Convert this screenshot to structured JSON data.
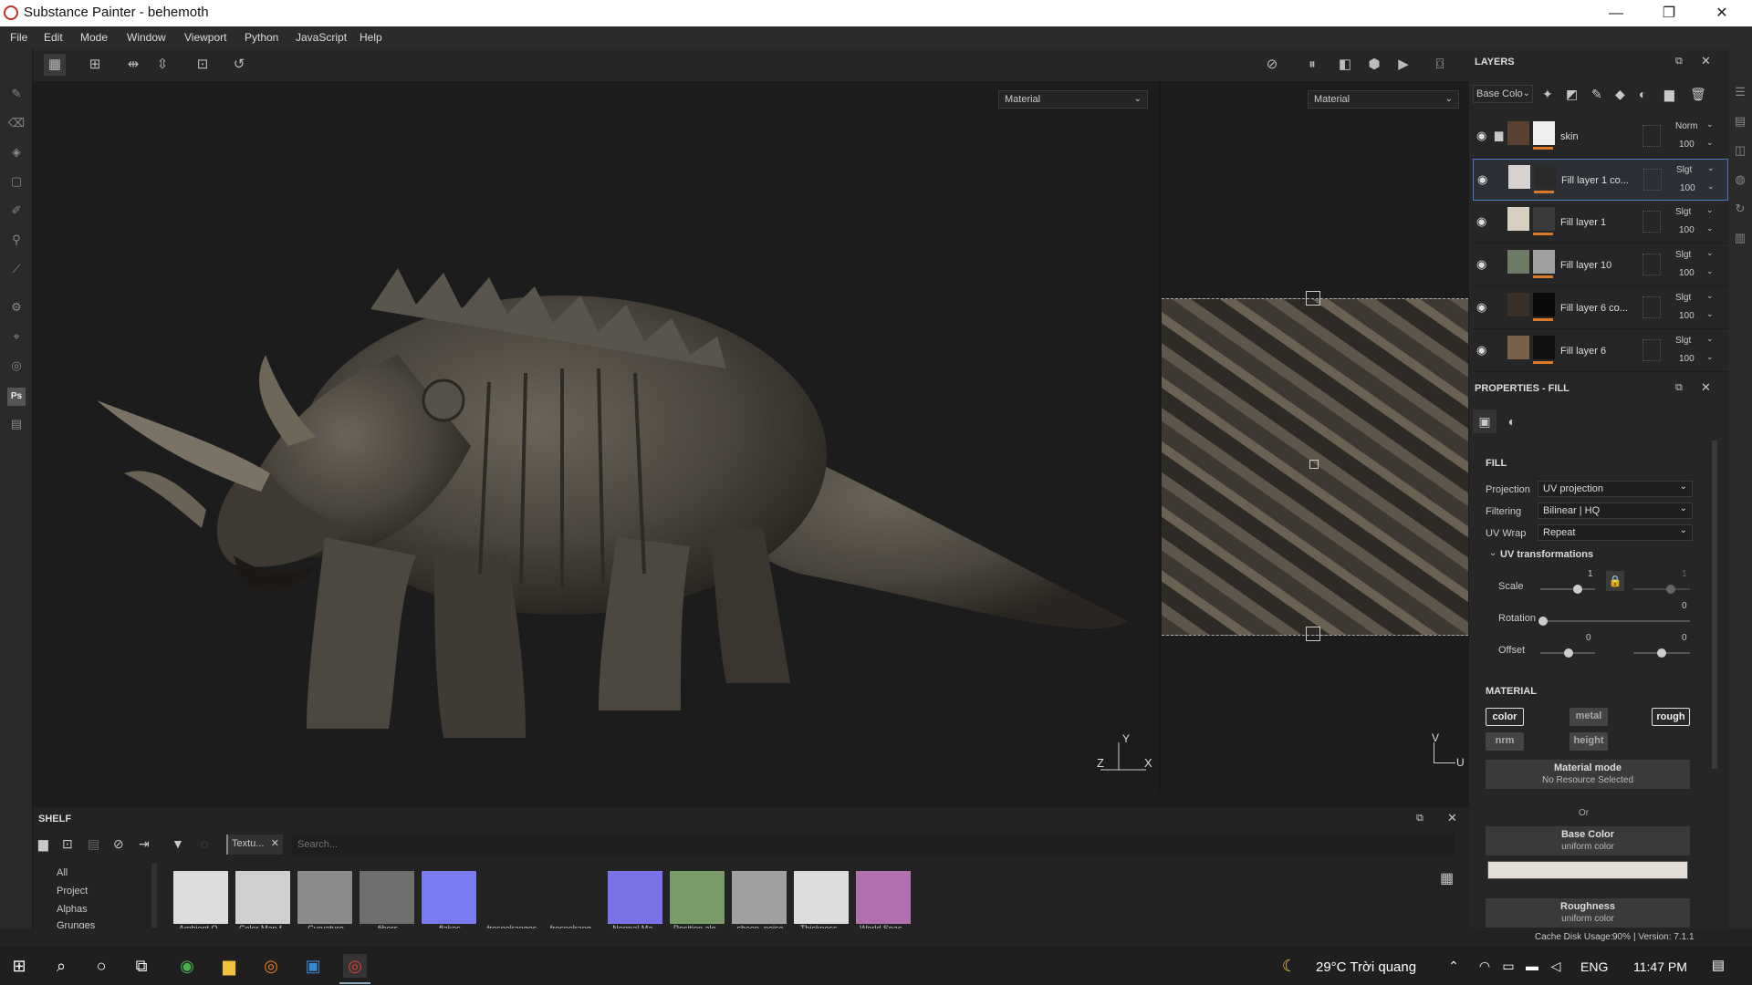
{
  "app": {
    "title": "Substance Painter - behemoth",
    "min": "—",
    "max": "❐",
    "close": "✕"
  },
  "menu": [
    "File",
    "Edit",
    "Mode",
    "Window",
    "Viewport",
    "Python",
    "JavaScript",
    "Help"
  ],
  "viewport": {
    "left_mode": "Material",
    "right_mode": "Material",
    "axis_y": "Y",
    "axis_x": "X",
    "axis_z": "Z",
    "uv_v": "V",
    "uv_u": "U"
  },
  "layers": {
    "title": "LAYERS",
    "channel": "Base Colo",
    "items": [
      {
        "name": "skin",
        "blend": "Norm",
        "opacity": "100",
        "color": "#5a4030",
        "mask": "#f0f0f0"
      },
      {
        "name": "Fill layer 1 co...",
        "blend": "Slgt",
        "opacity": "100",
        "color": "#d8d2ce",
        "mask": "#2a2a2a",
        "selected": true
      },
      {
        "name": "Fill layer 1",
        "blend": "Slgt",
        "opacity": "100",
        "color": "#d8cec2",
        "mask": "#3a3a3a"
      },
      {
        "name": "Fill layer 10",
        "blend": "Slgt",
        "opacity": "100",
        "color": "#6c7a66",
        "mask": "#a0a0a0"
      },
      {
        "name": "Fill layer 6 co...",
        "blend": "Slgt",
        "opacity": "100",
        "color": "#3a3028",
        "mask": "#0a0a0a"
      },
      {
        "name": "Fill layer 6",
        "blend": "Slgt",
        "opacity": "100",
        "color": "#7a6048",
        "mask": "#111"
      }
    ]
  },
  "properties": {
    "title": "PROPERTIES - FILL",
    "fill_label": "FILL",
    "projection_label": "Projection",
    "projection_value": "UV projection",
    "filtering_label": "Filtering",
    "filtering_value": "Bilinear | HQ",
    "uvwrap_label": "UV Wrap",
    "uvwrap_value": "Repeat",
    "uvtrans_label": "UV transformations",
    "scale_label": "Scale",
    "scale_value": "1",
    "scale_value2": "1",
    "rotation_label": "Rotation",
    "rotation_value": "0",
    "offset_label": "Offset",
    "offset_value1": "0",
    "offset_value2": "0",
    "material_label": "MATERIAL",
    "channels": {
      "color": "color",
      "metal": "metal",
      "rough": "rough",
      "nrm": "nrm",
      "height": "height"
    },
    "material_mode": "Material mode",
    "no_resource": "No Resource Selected",
    "or": "Or",
    "base_color": "Base Color",
    "uniform1": "uniform color",
    "roughness": "Roughness",
    "uniform2": "uniform color"
  },
  "shelf": {
    "title": "SHELF",
    "filter_tag": "Textu...",
    "search_placeholder": "Search...",
    "categories": [
      "All",
      "Project",
      "Alphas",
      "Grunges"
    ],
    "items": [
      {
        "label": "Ambient O...",
        "color": "#dcdcdc"
      },
      {
        "label": "Color Map f...",
        "color": "#cfcfcf"
      },
      {
        "label": "Curvature",
        "color": "#8a8a8a"
      },
      {
        "label": "fibers",
        "color": "#6e6e6e"
      },
      {
        "label": "flakes",
        "color": "#7a7af0"
      },
      {
        "label": "fresnelranges",
        "color": "#222"
      },
      {
        "label": "fresnelrang...",
        "color": "#222"
      },
      {
        "label": "Normal Ma...",
        "color": "#7a72e8"
      },
      {
        "label": "Position ale...",
        "color": "#7a9a6a"
      },
      {
        "label": "sheen_noise",
        "color": "#a0a0a0"
      },
      {
        "label": "Thickness...",
        "color": "#dcdcdc"
      },
      {
        "label": "World Spac...",
        "color": "#b070b0"
      }
    ]
  },
  "status": {
    "cache": "Cache Disk Usage:",
    "cache_value": "90%",
    "version": "| Version: 7.1.1"
  },
  "taskbar": {
    "weather": "29°C  Trời quang",
    "lang": "ENG",
    "time": "11:47 PM"
  }
}
